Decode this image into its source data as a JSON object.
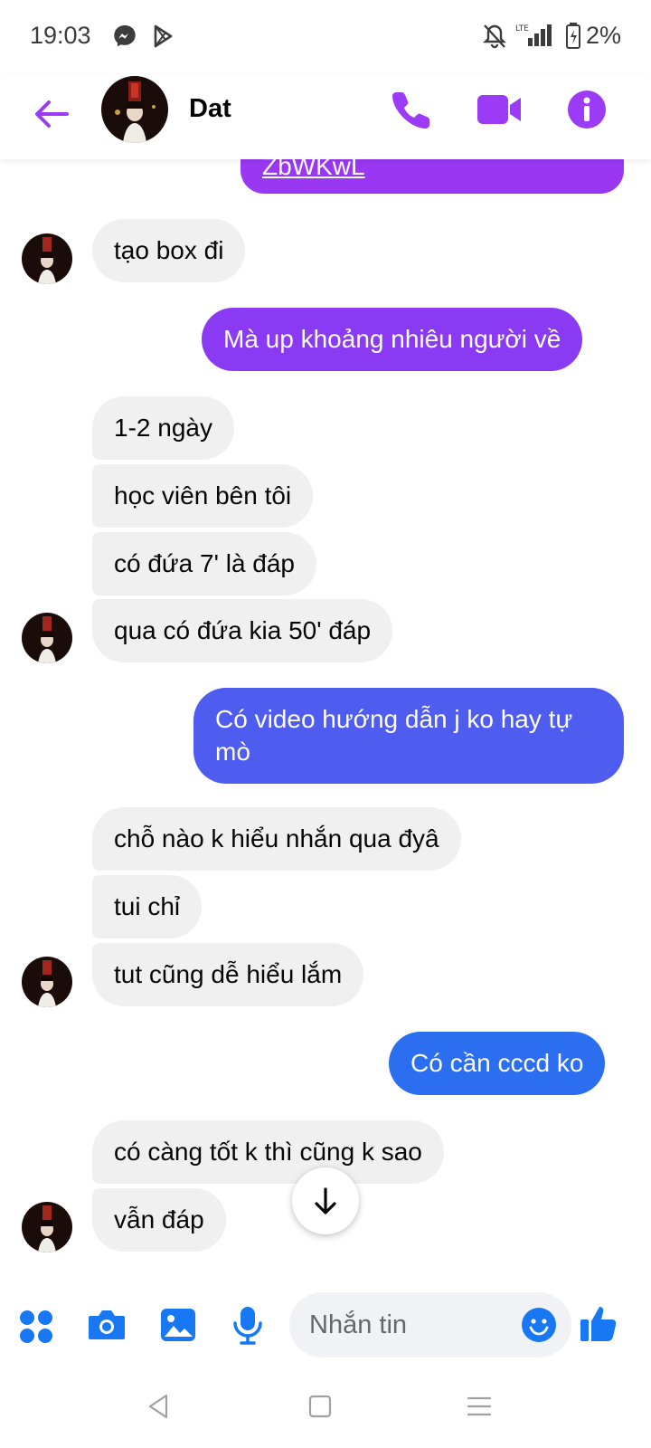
{
  "status_bar": {
    "time": "19:03",
    "battery": "2%"
  },
  "header": {
    "contact_name": "Dat"
  },
  "colors": {
    "accent": "#9b3bf5",
    "sent_purple": "#9a37f2",
    "sent_violet": "#7b3ff0",
    "sent_indigo": "#4f5cf0",
    "sent_blue": "#2b6ff0",
    "received_bg": "#f0f0f0",
    "composer_blue": "#1877f2"
  },
  "messages": [
    {
      "side": "sent",
      "text": "ZbWKwL",
      "link": true
    },
    {
      "side": "received",
      "text": "tạo box đi"
    },
    {
      "side": "sent",
      "text": "Mà up khoảng nhiêu người về"
    },
    {
      "side": "received",
      "text": "1-2 ngày"
    },
    {
      "side": "received",
      "text": "học viên bên tôi"
    },
    {
      "side": "received",
      "text": "có đứa 7' là đáp"
    },
    {
      "side": "received",
      "text": "qua có đứa kia 50' đáp"
    },
    {
      "side": "sent",
      "text": "Có video hướng dẫn j ko hay tự mò"
    },
    {
      "side": "received",
      "text": "chỗ nào k hiểu nhắn qua đyâ"
    },
    {
      "side": "received",
      "text": "tui chỉ"
    },
    {
      "side": "received",
      "text": "tut cũng dễ hiểu lắm"
    },
    {
      "side": "sent",
      "text": "Có cần cccd ko"
    },
    {
      "side": "received",
      "text": "có càng tốt k thì cũng k sao"
    },
    {
      "side": "received",
      "text": "vẫn đáp"
    }
  ],
  "composer": {
    "placeholder": "Nhắn tin"
  },
  "icons": {
    "back": "arrow-left-icon",
    "call": "phone-icon",
    "video": "video-camera-icon",
    "info": "info-icon",
    "apps": "grid-dots-icon",
    "camera": "camera-icon",
    "gallery": "image-icon",
    "mic": "microphone-icon",
    "emoji": "smiley-icon",
    "like": "thumbs-up-icon",
    "scroll": "arrow-down-icon"
  }
}
